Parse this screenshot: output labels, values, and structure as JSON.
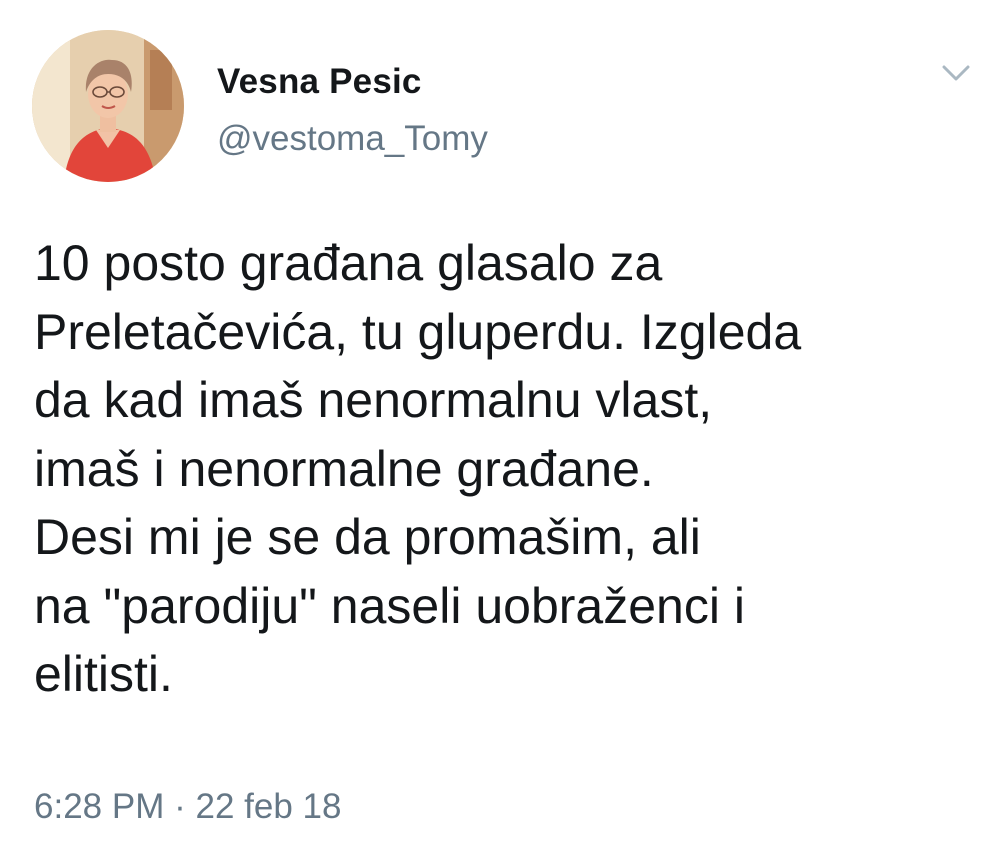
{
  "author": {
    "display_name": "Vesna Pesic",
    "handle": "@vestoma_Tomy",
    "avatar_icon": "profile-photo"
  },
  "tweet": {
    "text_lines": [
      "10 posto građana glasalo za",
      "Preletačevića, tu gluperdu. Izgleda",
      "da kad imaš nenormalnu vlast,",
      "imaš i nenormalne građane.",
      "Desi mi je se da promašim, ali",
      "na \"parodiju\" naseli uobraženci i",
      "elitisti."
    ],
    "time": "6:28 PM",
    "separator": "·",
    "date": "22 feb 18"
  },
  "menu": {
    "icon": "chevron-down-icon"
  },
  "colors": {
    "text": "#14171a",
    "secondary": "#657786",
    "caret": "#aab8c2",
    "background": "#ffffff"
  }
}
